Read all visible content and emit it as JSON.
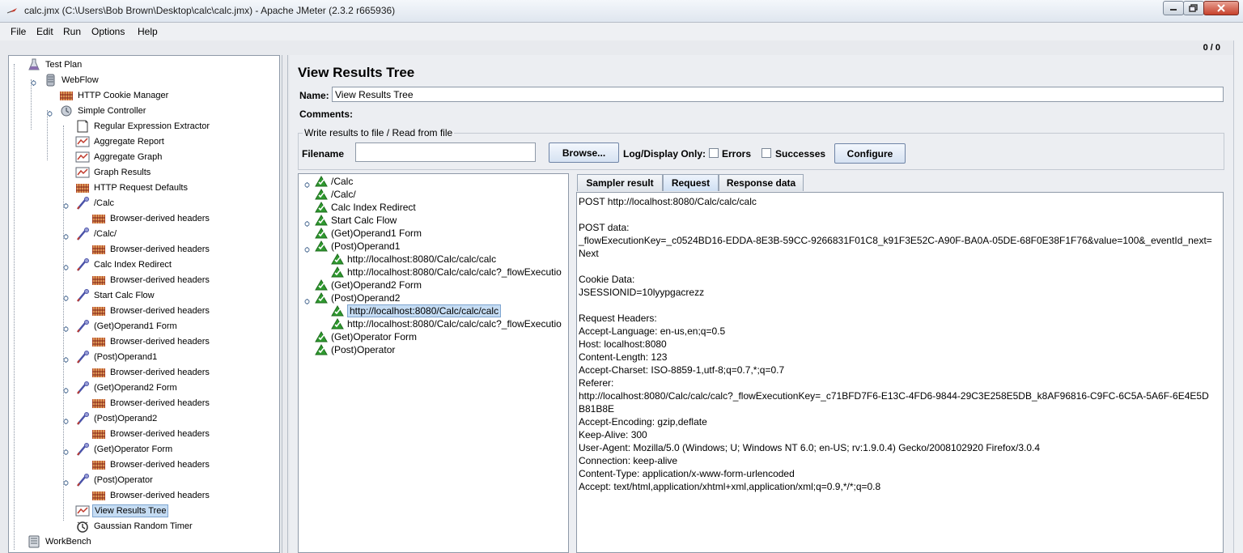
{
  "window": {
    "title": "calc.jmx (C:\\Users\\Bob Brown\\Desktop\\calc\\calc.jmx) - Apache JMeter (2.3.2 r665936)"
  },
  "menu": [
    "File",
    "Edit",
    "Run",
    "Options",
    "Help"
  ],
  "counter": "0 / 0",
  "tree": [
    {
      "label": "Test Plan",
      "icon": "test-plan-icon"
    },
    {
      "label": "WebFlow",
      "icon": "thread-group-icon"
    },
    {
      "label": "HTTP Cookie Manager",
      "icon": "config-element-icon"
    },
    {
      "label": "Simple Controller",
      "icon": "controller-icon"
    },
    {
      "label": "Regular Expression Extractor",
      "icon": "post-processor-icon"
    },
    {
      "label": "Aggregate Report",
      "icon": "listener-icon"
    },
    {
      "label": "Aggregate Graph",
      "icon": "listener-icon"
    },
    {
      "label": "Graph Results",
      "icon": "listener-icon"
    },
    {
      "label": "HTTP Request Defaults",
      "icon": "config-element-icon"
    },
    {
      "label": "/Calc",
      "icon": "sampler-icon"
    },
    {
      "label": "Browser-derived headers",
      "icon": "config-element-icon"
    },
    {
      "label": "/Calc/",
      "icon": "sampler-icon"
    },
    {
      "label": "Browser-derived headers",
      "icon": "config-element-icon"
    },
    {
      "label": "Calc Index Redirect",
      "icon": "sampler-icon"
    },
    {
      "label": "Browser-derived headers",
      "icon": "config-element-icon"
    },
    {
      "label": "Start Calc Flow",
      "icon": "sampler-icon"
    },
    {
      "label": "Browser-derived headers",
      "icon": "config-element-icon"
    },
    {
      "label": "(Get)Operand1 Form",
      "icon": "sampler-icon"
    },
    {
      "label": "Browser-derived headers",
      "icon": "config-element-icon"
    },
    {
      "label": "(Post)Operand1",
      "icon": "sampler-icon"
    },
    {
      "label": "Browser-derived headers",
      "icon": "config-element-icon"
    },
    {
      "label": "(Get)Operand2 Form",
      "icon": "sampler-icon"
    },
    {
      "label": "Browser-derived headers",
      "icon": "config-element-icon"
    },
    {
      "label": "(Post)Operand2",
      "icon": "sampler-icon"
    },
    {
      "label": "Browser-derived headers",
      "icon": "config-element-icon"
    },
    {
      "label": "(Get)Operator Form",
      "icon": "sampler-icon"
    },
    {
      "label": "Browser-derived headers",
      "icon": "config-element-icon"
    },
    {
      "label": "(Post)Operator",
      "icon": "sampler-icon"
    },
    {
      "label": "Browser-derived headers",
      "icon": "config-element-icon"
    },
    {
      "label": "View Results Tree",
      "icon": "listener-icon",
      "selected": true
    },
    {
      "label": "Gaussian Random Timer",
      "icon": "timer-icon"
    },
    {
      "label": "WorkBench",
      "icon": "workbench-icon"
    }
  ],
  "panel": {
    "title": "View Results Tree",
    "name_label": "Name:",
    "name_value": "View Results Tree",
    "comments_label": "Comments:",
    "file_group_title": "Write results to file / Read from file",
    "filename_label": "Filename",
    "filename_value": "",
    "browse_label": "Browse...",
    "log_display_label": "Log/Display Only:",
    "errors_label": "Errors",
    "successes_label": "Successes",
    "configure_label": "Configure"
  },
  "results": [
    {
      "label": "/Calc"
    },
    {
      "label": "/Calc/"
    },
    {
      "label": "Calc Index Redirect"
    },
    {
      "label": "Start Calc Flow"
    },
    {
      "label": "(Get)Operand1 Form"
    },
    {
      "label": "(Post)Operand1"
    },
    {
      "label": "http://localhost:8080/Calc/calc/calc"
    },
    {
      "label": "http://localhost:8080/Calc/calc/calc?_flowExecutio"
    },
    {
      "label": "(Get)Operand2 Form"
    },
    {
      "label": "(Post)Operand2"
    },
    {
      "label": "http://localhost:8080/Calc/calc/calc",
      "selected": true
    },
    {
      "label": "http://localhost:8080/Calc/calc/calc?_flowExecutio"
    },
    {
      "label": "(Get)Operator Form"
    },
    {
      "label": "(Post)Operator"
    }
  ],
  "tabs": [
    {
      "label": "Sampler result"
    },
    {
      "label": "Request",
      "active": true
    },
    {
      "label": "Response data"
    }
  ],
  "request_lines": [
    "POST http://localhost:8080/Calc/calc/calc",
    "",
    "POST data:",
    "_flowExecutionKey=_c0524BD16-EDDA-8E3B-59CC-9266831F01C8_k91F3E52C-A90F-BA0A-05DE-68F0E38F1F76&value=100&_eventId_next=",
    "Next",
    "",
    "Cookie Data:",
    "JSESSIONID=10lyypgacrezz",
    "",
    "Request Headers:",
    "Accept-Language: en-us,en;q=0.5",
    "Host: localhost:8080",
    "Content-Length: 123",
    "Accept-Charset: ISO-8859-1,utf-8;q=0.7,*;q=0.7",
    "Referer:",
    "http://localhost:8080/Calc/calc/calc?_flowExecutionKey=_c71BFD7F6-E13C-4FD6-9844-29C3E258E5DB_k8AF96816-C9FC-6C5A-5A6F-6E4E5D",
    "B81B8E",
    "Accept-Encoding: gzip,deflate",
    "Keep-Alive: 300",
    "User-Agent: Mozilla/5.0 (Windows; U; Windows NT 6.0; en-US; rv:1.9.0.4) Gecko/2008102920 Firefox/3.0.4",
    "Connection: keep-alive",
    "Content-Type: application/x-www-form-urlencoded",
    "Accept: text/html,application/xhtml+xml,application/xml;q=0.9,*/*;q=0.8"
  ],
  "colors": {
    "selection": "#c5dcf3",
    "sampler_ok": "#2f9a2f"
  }
}
